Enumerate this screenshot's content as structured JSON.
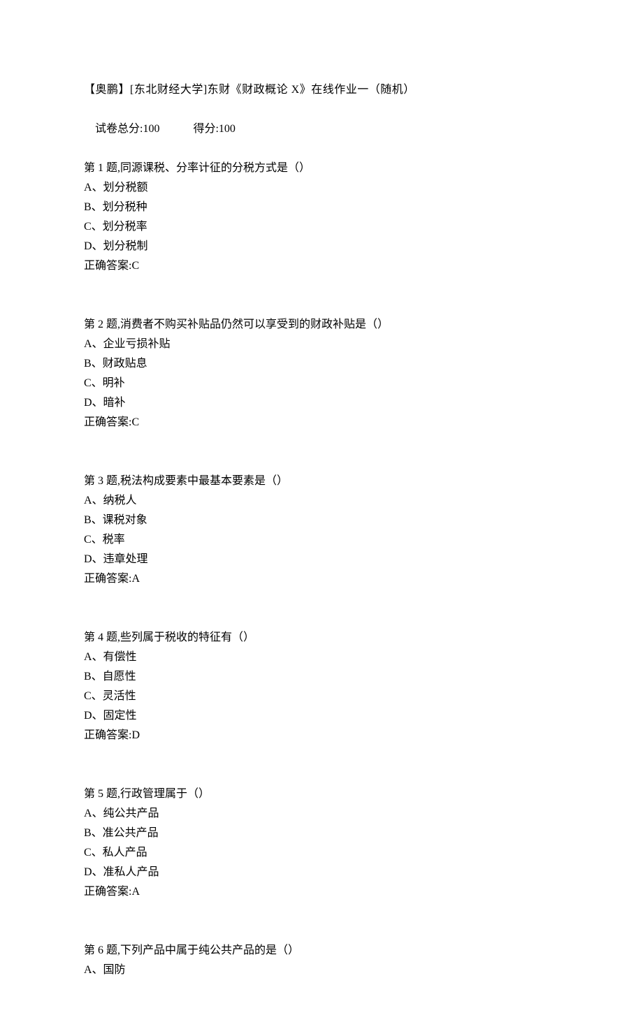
{
  "header": {
    "title": "【奥鹏】[东北财经大学]东财《财政概论 X》在线作业一（随机）",
    "score_total_label": "试卷总分:100",
    "score_got_label": "得分:100"
  },
  "questions": [
    {
      "stem": "第 1 题,同源课税、分率计征的分税方式是（）",
      "options": [
        "A、划分税额",
        "B、划分税种",
        "C、划分税率",
        "D、划分税制"
      ],
      "answer": "正确答案:C"
    },
    {
      "stem": "第 2 题,消费者不购买补贴品仍然可以享受到的财政补贴是（）",
      "options": [
        "A、企业亏损补贴",
        "B、财政贴息",
        "C、明补",
        "D、暗补"
      ],
      "answer": "正确答案:C"
    },
    {
      "stem": "第 3 题,税法构成要素中最基本要素是（）",
      "options": [
        "A、纳税人",
        "B、课税对象",
        "C、税率",
        "D、违章处理"
      ],
      "answer": "正确答案:A"
    },
    {
      "stem": "第 4 题,些列属于税收的特征有（）",
      "options": [
        "A、有偿性",
        "B、自愿性",
        "C、灵活性",
        "D、固定性"
      ],
      "answer": "正确答案:D"
    },
    {
      "stem": "第 5 题,行政管理属于（）",
      "options": [
        "A、纯公共产品",
        "B、准公共产品",
        "C、私人产品",
        "D、准私人产品"
      ],
      "answer": "正确答案:A"
    },
    {
      "stem": "第 6 题,下列产品中属于纯公共产品的是（）",
      "options": [
        "A、国防"
      ],
      "answer": ""
    }
  ]
}
